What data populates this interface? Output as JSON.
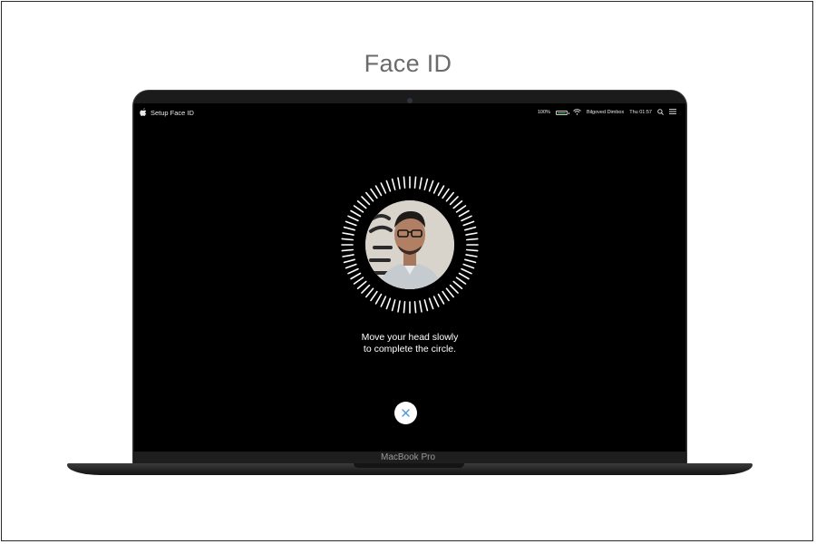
{
  "page": {
    "title": "Face ID"
  },
  "menubar": {
    "app_name": "Setup Face ID",
    "battery": "100%",
    "battery_level": 1.0,
    "wifi_name": "Bilgoved Dimbox",
    "clock": "Thu 01:57",
    "icons": [
      "apple-icon",
      "wifi-icon",
      "search-icon",
      "list-icon"
    ]
  },
  "faceid": {
    "prompt_line1": "Move your head slowly",
    "prompt_line2": "to complete the circle.",
    "cancel_icon": "close-icon",
    "cancel_icon_color": "#4a90e2"
  },
  "device": {
    "model": "MacBook Pro"
  }
}
